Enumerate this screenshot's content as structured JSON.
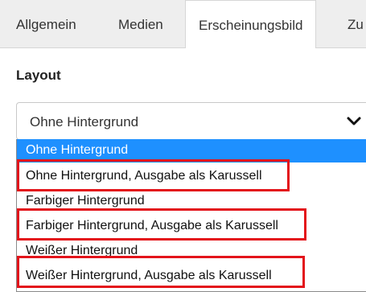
{
  "tabs": [
    {
      "label": "Allgemein"
    },
    {
      "label": "Medien"
    },
    {
      "label": "Erscheinungsbild",
      "active": true
    },
    {
      "label": "Zu"
    }
  ],
  "layout": {
    "label": "Layout",
    "selected_value": "Ohne Hintergrund",
    "options": [
      {
        "label": "Ohne Hintergrund",
        "selected": true
      },
      {
        "label": "Ohne Hintergrund, Ausgabe als Karussell",
        "highlighted": true
      },
      {
        "label": "Farbiger Hintergrund"
      },
      {
        "label": "Farbiger Hintergrund, Ausgabe als Karussell",
        "highlighted": true
      },
      {
        "label": "Weißer Hintergrund"
      },
      {
        "label": "Weißer Hintergrund, Ausgabe als Karussell",
        "highlighted": true
      }
    ]
  },
  "colors": {
    "selected_option_bg": "#1e90ff",
    "highlight_box": "#e3141b",
    "tabbar_bg": "#eeeeee"
  }
}
